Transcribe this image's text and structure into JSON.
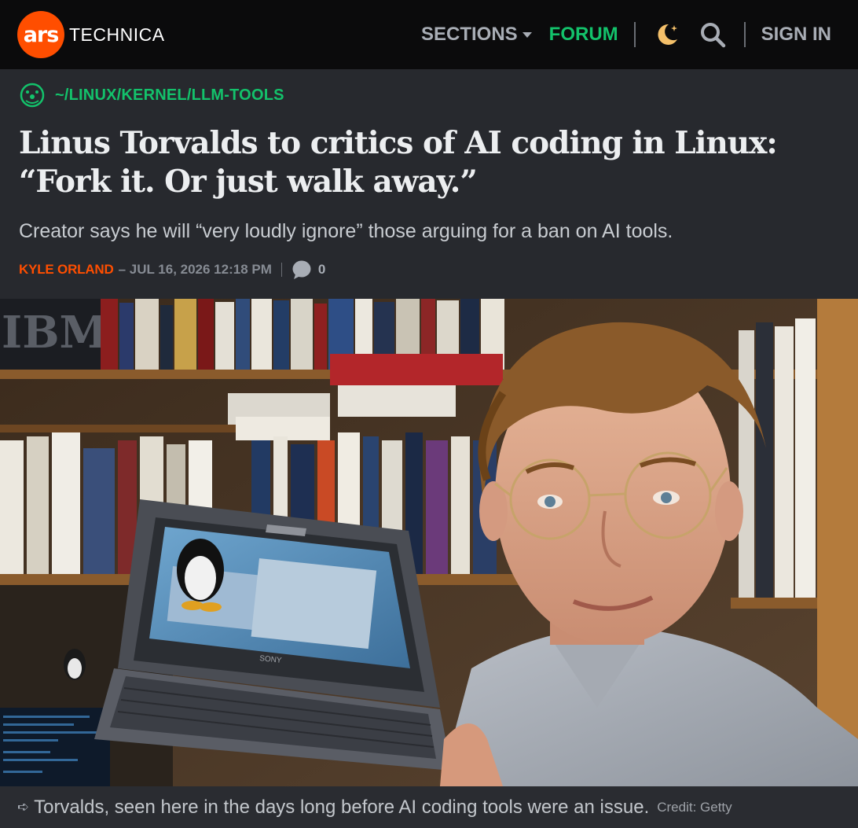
{
  "site": {
    "logo_mark": "ars",
    "logo_word": "TECHNICA",
    "brand_color": "#ff4e00"
  },
  "nav": {
    "sections_label": "SECTIONS",
    "forum_label": "FORUM",
    "signin_label": "SIGN IN",
    "icons": [
      "chevron-down-icon",
      "moon-icon",
      "search-icon"
    ],
    "accent_color": "#13c26b"
  },
  "article": {
    "breadcrumb": "~/LINUX/KERNEL/LLM-TOOLS",
    "title_line1": "Linus Torvalds to critics of AI coding in Linux:",
    "title_line2": "“Fork it. Or just walk away.”",
    "dek": "Creator says he will “very loudly ignore” those arguing for a ban on AI tools.",
    "author": "KYLE ORLAND",
    "date": "– JUL 16, 2026 12:18 PM",
    "comment_count": "0"
  },
  "image": {
    "caption": "Torvalds, seen here in the days long before AI coding tools were an issue.",
    "credit": "Credit: Getty",
    "laptop_brand": "SONY",
    "shelf_sign": "IBM"
  }
}
